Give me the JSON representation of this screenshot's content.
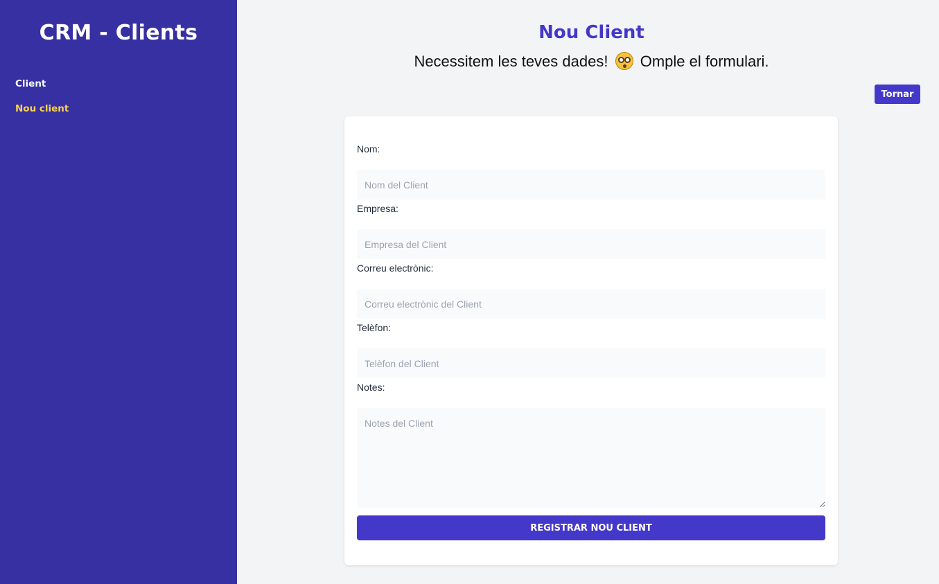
{
  "sidebar": {
    "brand": "CRM - Clients",
    "nav": [
      {
        "label": "Client",
        "active": false
      },
      {
        "label": "Nou client",
        "active": true
      }
    ],
    "colors": {
      "background": "#3730a3",
      "active_link": "#fcd34d"
    }
  },
  "header": {
    "title": "Nou Client",
    "subtitle_before": "Necessitem les teves dades!",
    "subtitle_after": "Omple el formulari.",
    "emoji_icon": "flushed-face-icon",
    "back_label": "Tornar"
  },
  "form": {
    "nom": {
      "label": "Nom:",
      "placeholder": "Nom del Client",
      "value": ""
    },
    "empresa": {
      "label": "Empresa:",
      "placeholder": "Empresa del Client",
      "value": ""
    },
    "email": {
      "label": "Correu electrònic:",
      "placeholder": "Correu electrònic del Client",
      "value": ""
    },
    "telefon": {
      "label": "Telèfon:",
      "placeholder": "Telèfon del Client",
      "value": ""
    },
    "notes": {
      "label": "Notes:",
      "placeholder": "Notes del Client",
      "value": ""
    },
    "submit_label": "Registrar nou client"
  },
  "colors": {
    "accent": "#4338ca",
    "page_bg": "#f3f4f6"
  }
}
